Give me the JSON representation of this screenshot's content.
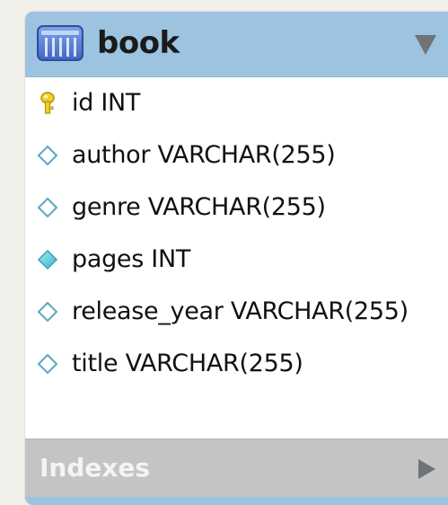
{
  "table": {
    "name": "book",
    "columns": [
      {
        "label": "id INT",
        "icon": "primary-key-icon"
      },
      {
        "label": "author VARCHAR(255)",
        "icon": "nullable-column-icon"
      },
      {
        "label": "genre VARCHAR(255)",
        "icon": "nullable-column-icon"
      },
      {
        "label": "pages INT",
        "icon": "not-null-column-icon"
      },
      {
        "label": "release_year VARCHAR(255)",
        "icon": "nullable-column-icon"
      },
      {
        "label": "title VARCHAR(255)",
        "icon": "nullable-column-icon"
      }
    ],
    "indexes_label": "Indexes"
  },
  "colors": {
    "header": "#9cc4e0",
    "indexes_bar": "#c4c4c4",
    "background": "#f0efe9",
    "key_icon": "#e8c21a",
    "filled_diamond": "#5cc6d6"
  }
}
